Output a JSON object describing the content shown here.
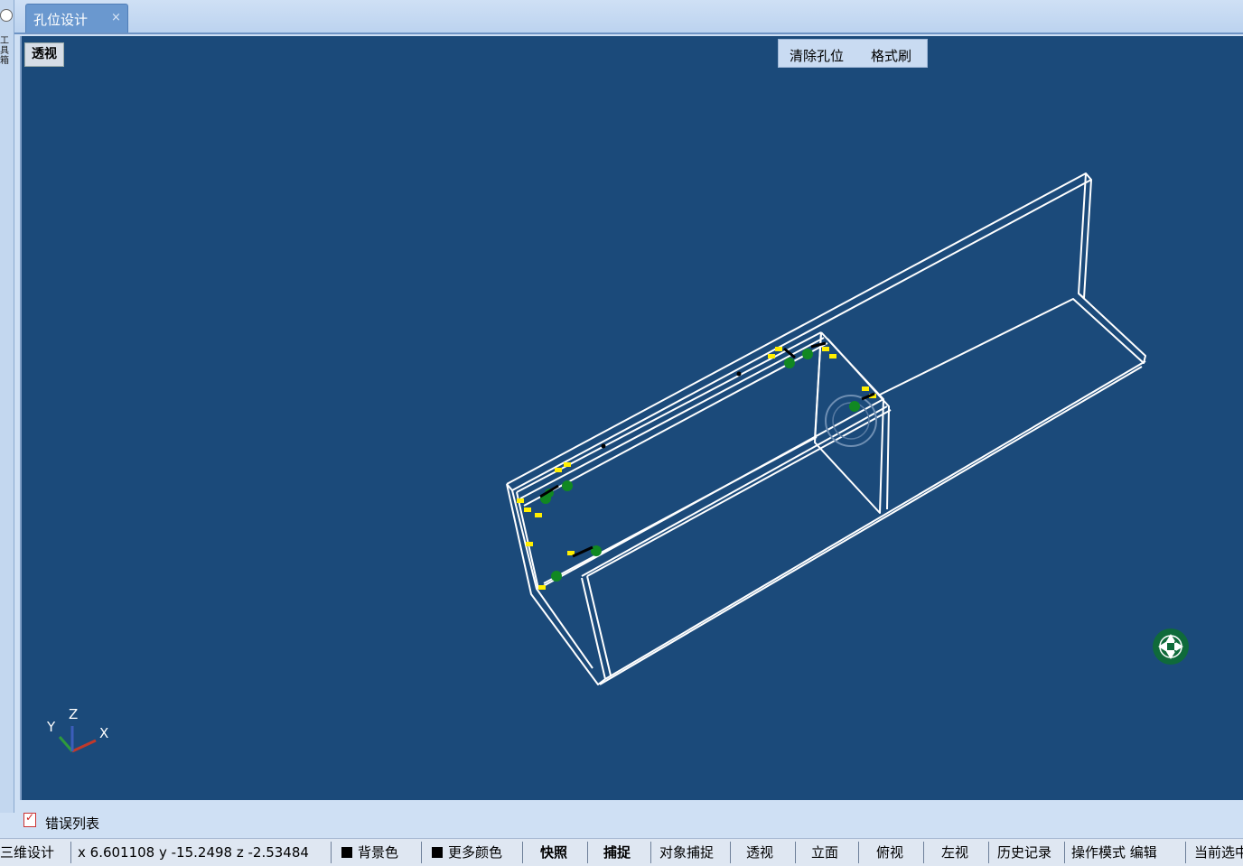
{
  "left_panel": {
    "vertical_label": "工具箱"
  },
  "tab": {
    "label": "孔位设计",
    "close": "×"
  },
  "viewport": {
    "perspective_button": "透视",
    "toolbar": {
      "clear_holes": "清除孔位",
      "format_brush": "格式刷"
    },
    "background_color": "#1b4a7a",
    "axis": {
      "x": "X",
      "y": "Y",
      "z": "Z"
    }
  },
  "error_list": {
    "label": "错误列表"
  },
  "status": {
    "mode": "三维设计",
    "coords": "x 6.601108 y -15.2498 z -2.53484",
    "background_color": "背景色",
    "more_colors": "更多颜色",
    "snapshot": "快照",
    "snap": "捕捉",
    "object_snap": "对象捕捉",
    "perspective": "透视",
    "elevation": "立面",
    "top_view": "俯视",
    "left_view": "左视",
    "history": "历史记录",
    "operation_mode": "操作模式 编辑",
    "current_selection": "当前选中"
  }
}
